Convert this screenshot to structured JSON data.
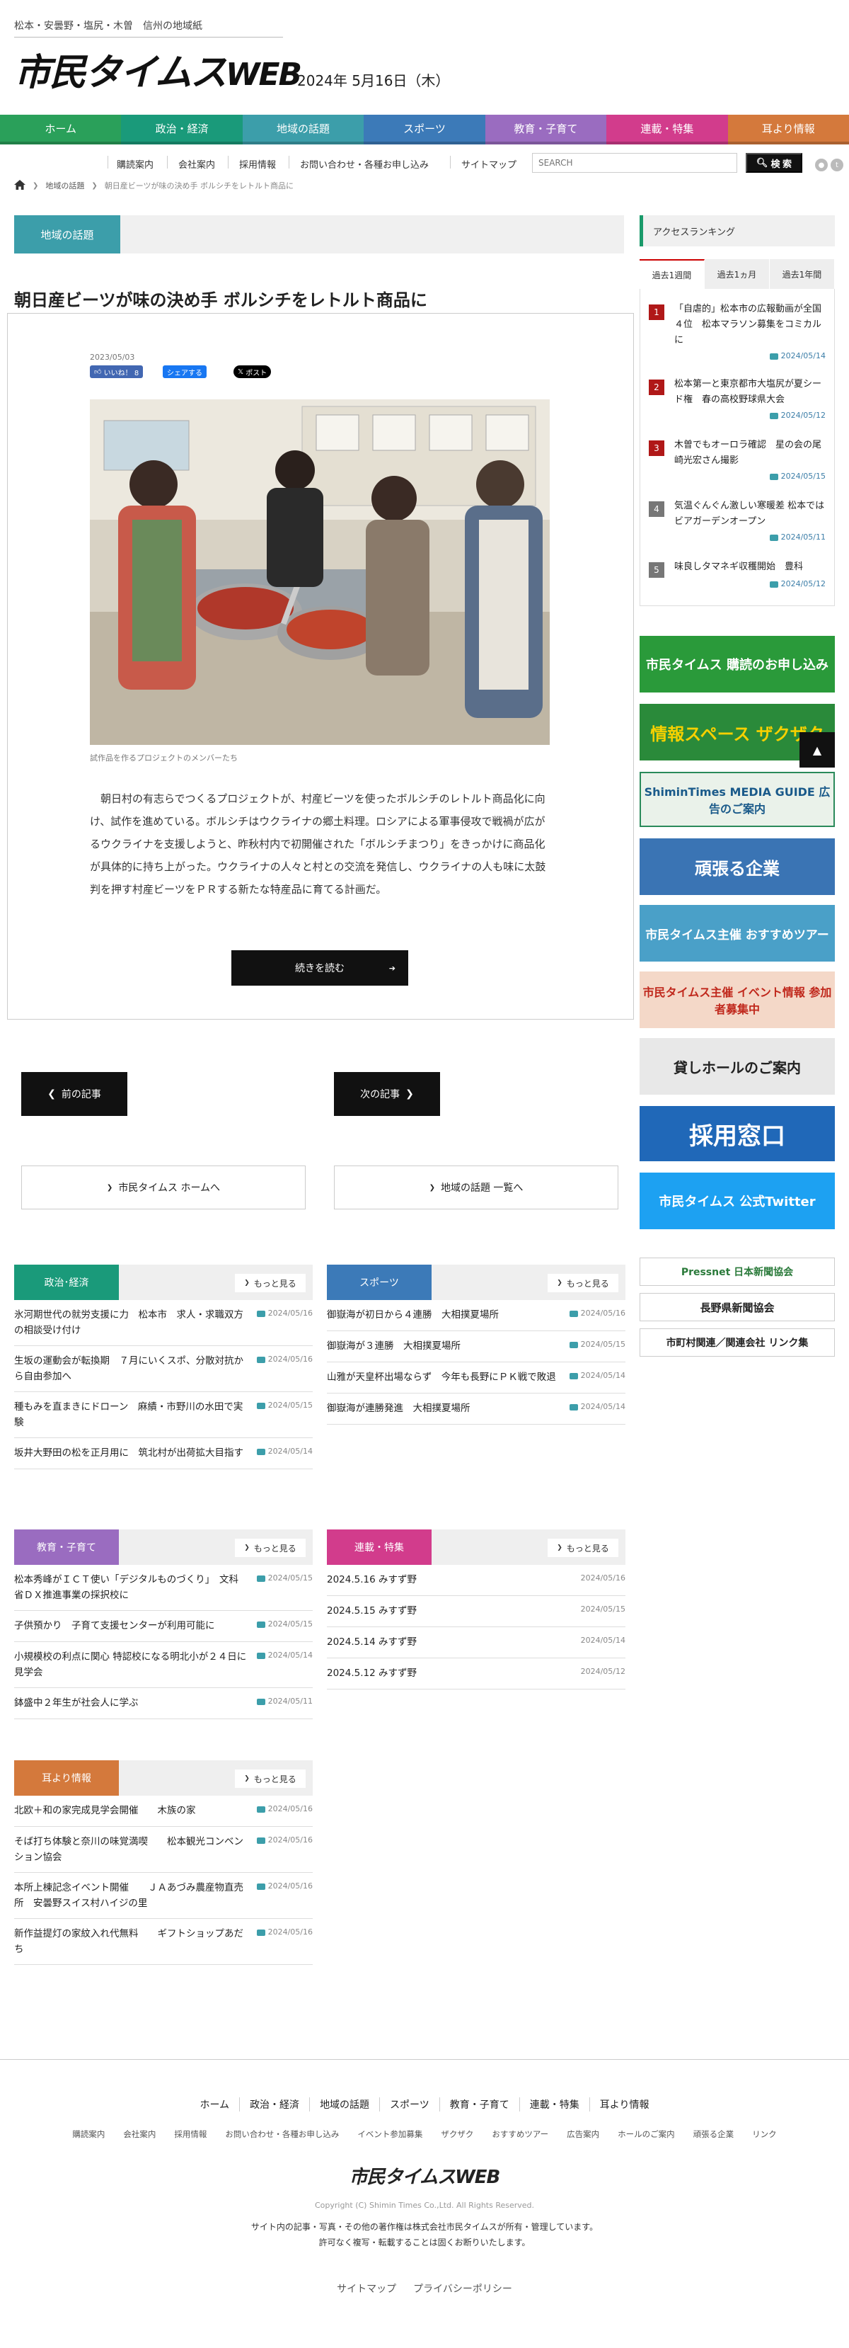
{
  "header": {
    "tagline": "松本・安曇野・塩尻・木曽　信州の地域紙",
    "logo_main": "市民タイムス",
    "logo_web": "WEB",
    "date": "2024年 5月16日（木）"
  },
  "nav": [
    {
      "label": "ホーム",
      "color": "#2aa05a"
    },
    {
      "label": "政治・経済",
      "color": "#1a9a7a"
    },
    {
      "label": "地域の話題",
      "color": "#3c9eaa"
    },
    {
      "label": "スポーツ",
      "color": "#3c7ab8"
    },
    {
      "label": "教育・子育て",
      "color": "#9a6cc0"
    },
    {
      "label": "連載・特集",
      "color": "#d23c8c"
    },
    {
      "label": "耳より情報",
      "color": "#d4793c"
    }
  ],
  "util": {
    "links": [
      "購読案内",
      "会社案内",
      "採用情報",
      "お問い合わせ・各種お申し込み",
      "サイトマップ"
    ],
    "search_placeholder": "SEARCH",
    "search_button": "検 索"
  },
  "breadcrumb": {
    "level1": "地域の話題",
    "current": "朝日産ビーツが味の決め手 ボルシチをレトルト商品に"
  },
  "article": {
    "category": "地域の話題",
    "title": "朝日産ビーツが味の決め手 ボルシチをレトルト商品に",
    "date": "2023/05/03",
    "like_label": "いいね！ 8",
    "share_label": "シェアする",
    "post_label": "ポスト",
    "caption": "試作品を作るプロジェクトのメンバーたち",
    "body": "朝日村の有志らでつくるプロジェクトが、村産ビーツを使ったボルシチのレトルト商品化に向け、試作を進めている。ボルシチはウクライナの郷土料理。ロシアによる軍事侵攻で戦禍が広がるウクライナを支援しようと、昨秋村内で初開催された「ボルシチまつり」をきっかけに商品化が具体的に持ち上がった。ウクライナの人々と村との交流を発信し、ウクライナの人も味に太鼓判を押す村産ビーツをＰＲする新たな特産品に育てる計画だ。",
    "readmore": "続きを読む",
    "prev": "前の記事",
    "next": "次の記事",
    "link_home": "市民タイムス ホームへ",
    "link_list": "地域の話題 一覧へ"
  },
  "sections": {
    "more_label": "もっと見る",
    "politics": {
      "label": "政治･経済",
      "color": "#1a9a7a",
      "items": [
        {
          "title": "氷河期世代の就労支援に力　松本市　求人・求職双方の相談受け付け",
          "date": "2024/05/16"
        },
        {
          "title": "生坂の運動会が転換期　７月にいくスポ、分散対抗から自由参加へ",
          "date": "2024/05/16"
        },
        {
          "title": "種もみを直まきにドローン　麻績・市野川の水田で実験",
          "date": "2024/05/15"
        },
        {
          "title": "坂井大野田の松を正月用に　筑北村が出荷拡大目指す",
          "date": "2024/05/14"
        }
      ]
    },
    "sports": {
      "label": "スポーツ",
      "color": "#3c7ab8",
      "items": [
        {
          "title": "御嶽海が初日から４連勝　大相撲夏場所",
          "date": "2024/05/16"
        },
        {
          "title": "御嶽海が３連勝　大相撲夏場所",
          "date": "2024/05/15"
        },
        {
          "title": "山雅が天皇杯出場ならず　今年も長野にＰＫ戦で敗退",
          "date": "2024/05/14"
        },
        {
          "title": "御嶽海が連勝発進　大相撲夏場所",
          "date": "2024/05/14"
        }
      ]
    },
    "education": {
      "label": "教育・子育て",
      "color": "#9a6cc0",
      "items": [
        {
          "title": "松本秀峰がＩＣＴ使い「デジタルものづくり」　文科省ＤＸ推進事業の採択校に",
          "date": "2024/05/15"
        },
        {
          "title": "子供預かり　子育て支援センターが利用可能に",
          "date": "2024/05/15"
        },
        {
          "title": "小規模校の利点に関心 特認校になる明北小が２４日に見学会",
          "date": "2024/05/14"
        },
        {
          "title": "鉢盛中２年生が社会人に学ぶ",
          "date": "2024/05/11"
        }
      ]
    },
    "series": {
      "label": "連載・特集",
      "color": "#d23c8c",
      "items": [
        {
          "title": "2024.5.16 みすず野",
          "date": "2024/05/16"
        },
        {
          "title": "2024.5.15 みすず野",
          "date": "2024/05/15"
        },
        {
          "title": "2024.5.14 みすず野",
          "date": "2024/05/14"
        },
        {
          "title": "2024.5.12 みすず野",
          "date": "2024/05/12"
        }
      ]
    },
    "info": {
      "label": "耳より情報",
      "color": "#d4793c",
      "items": [
        {
          "title": "北欧＋和の家完成見学会開催　　木族の家",
          "date": "2024/05/16"
        },
        {
          "title": "そば打ち体験と奈川の味覚満喫　　松本観光コンベンション協会",
          "date": "2024/05/16"
        },
        {
          "title": "本所上棟記念イベント開催　　ＪＡあづみ農産物直売所　安曇野スイス村ハイジの里",
          "date": "2024/05/16"
        },
        {
          "title": "新作益提灯の家紋入れ代無料　　ギフトショップあだち",
          "date": "2024/05/16"
        }
      ]
    }
  },
  "ranking": {
    "title": "アクセスランキング",
    "tabs": [
      "過去1週間",
      "過去1ヵ月",
      "過去1年間"
    ],
    "items": [
      {
        "rank": "1",
        "title": "「自虐的」松本市の広報動画が全国４位　松本マラソン募集をコミカルに",
        "date": "2024/05/14",
        "color": "#b01818"
      },
      {
        "rank": "2",
        "title": "松本第一と東京都市大塩尻が夏シード権　春の高校野球県大会",
        "date": "2024/05/12",
        "color": "#b01818"
      },
      {
        "rank": "3",
        "title": "木曽でもオーロラ確認　星の会の尾崎光宏さん撮影",
        "date": "2024/05/15",
        "color": "#b01818"
      },
      {
        "rank": "4",
        "title": "気温ぐんぐん激しい寒暖差 松本ではビアガーデンオープン",
        "date": "2024/05/11",
        "color": "#777777"
      },
      {
        "rank": "5",
        "title": "味良しタマネギ収穫開始　豊科",
        "date": "2024/05/12",
        "color": "#777777"
      }
    ]
  },
  "banners": [
    {
      "text": "市民タイムス 購読のお申し込み",
      "bg": "#2a9a3a"
    },
    {
      "text": "情報スペース ザクザク",
      "bg": "#2a8a3a"
    },
    {
      "text": "ShiminTimes MEDIA GUIDE 広告のご案内",
      "bg": "#eaf2ea"
    },
    {
      "text": "頑張る企業",
      "bg": "#3a74b4"
    },
    {
      "text": "市民タイムス主催 おすすめツアー",
      "bg": "#4aa0c8"
    },
    {
      "text": "市民タイムス主催 イベント情報 参加者募集中",
      "bg": "#f4d8c8"
    },
    {
      "text": "貸しホールのご案内",
      "bg": "#e8e8e8"
    },
    {
      "text": "採用窓口",
      "bg": "#2068b8"
    },
    {
      "text": "市民タイムス 公式Twitter",
      "bg": "#1da1f2"
    },
    {
      "text": "Pressnet 日本新聞協会",
      "bg": "#ffffff"
    },
    {
      "text": "長野県新聞協会",
      "bg": "#ffffff"
    },
    {
      "text": "市町村関連／関連会社 リンク集",
      "bg": "#ffffff"
    }
  ],
  "footer": {
    "nav": [
      "ホーム",
      "政治・経済",
      "地域の話題",
      "スポーツ",
      "教育・子育て",
      "連載・特集",
      "耳より情報"
    ],
    "sub": [
      "購読案内",
      "会社案内",
      "採用情報",
      "お問い合わせ・各種お申し込み",
      "イベント参加募集",
      "ザクザク",
      "おすすめツアー",
      "広告案内",
      "ホールのご案内",
      "頑張る企業",
      "リンク"
    ],
    "logo": "市民タイムスWEB",
    "copyright": "Copyright (C) Shimin Times Co.,Ltd. All Rights Reserved.",
    "notice1": "サイト内の記事・写真・その他の著作権は株式会社市民タイムスが所有・管理しています。",
    "notice2": "許可なく複写・転載することは固くお断りいたします。",
    "bottom": [
      "サイトマップ",
      "プライバシーポリシー"
    ]
  }
}
